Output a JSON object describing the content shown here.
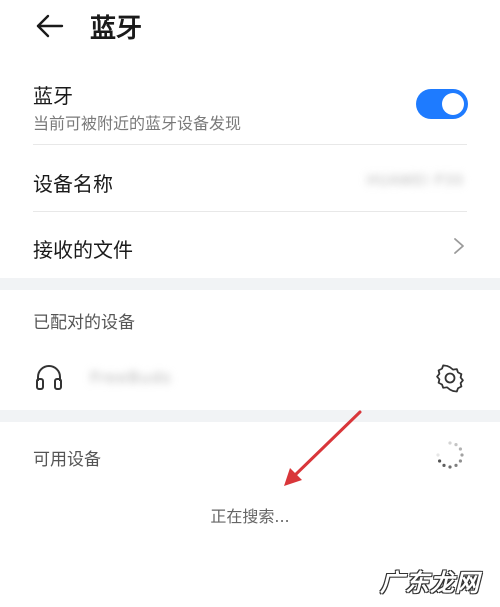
{
  "header": {
    "title": "蓝牙"
  },
  "bluetooth": {
    "label": "蓝牙",
    "subtitle": "当前可被附近的蓝牙设备发现",
    "enabled": true,
    "accent_color": "#1e7bff"
  },
  "device_name": {
    "label": "设备名称",
    "value": "HUAWEI P30"
  },
  "received_files": {
    "label": "接收的文件"
  },
  "paired_section": {
    "title": "已配对的设备",
    "devices": [
      {
        "name": "FreeBuds",
        "icon": "headset-icon"
      }
    ]
  },
  "available_section": {
    "title": "可用设备",
    "status": "正在搜索..."
  },
  "watermark": {
    "text": "广东龙网"
  }
}
